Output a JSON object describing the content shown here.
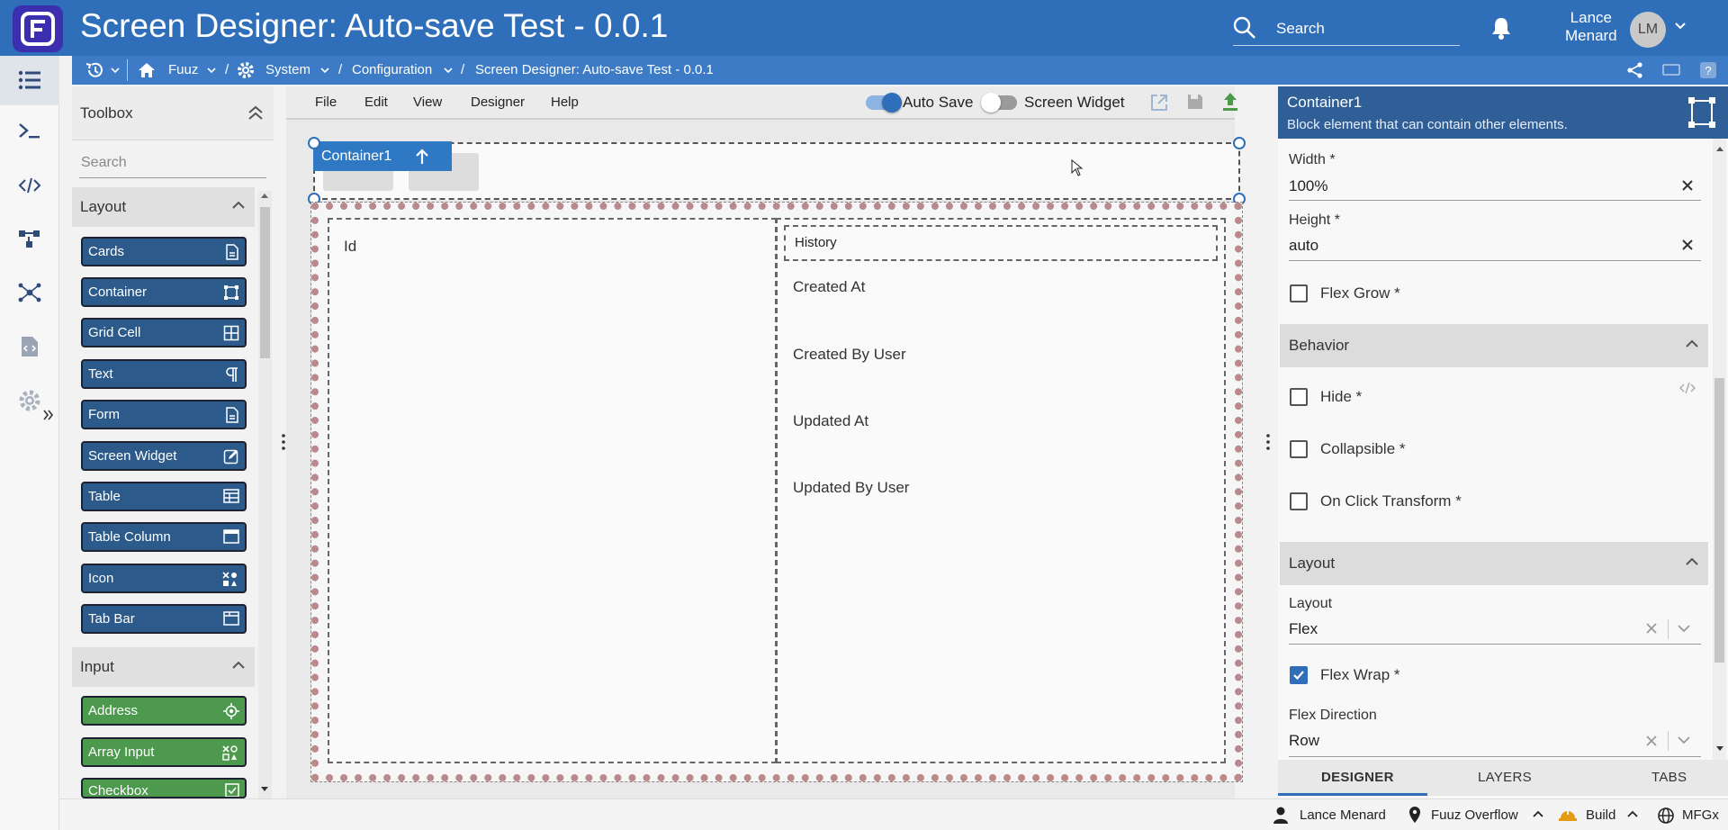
{
  "app": {
    "title": "Screen Designer: Auto-save Test - 0.0.1",
    "logo_letter": "F"
  },
  "header": {
    "search_label": "Search",
    "user_first": "Lance",
    "user_last": "Menard",
    "avatar_initials": "LM"
  },
  "breadcrumb": {
    "items": [
      "Fuuz",
      "System",
      "Configuration",
      "Screen Designer: Auto-save Test - 0.0.1"
    ]
  },
  "toolbox": {
    "title": "Toolbox",
    "search_placeholder": "Search",
    "layout_section": "Layout",
    "layout_items": [
      "Cards",
      "Container",
      "Grid Cell",
      "Text",
      "Form",
      "Screen Widget",
      "Table",
      "Table Column",
      "Icon",
      "Tab Bar"
    ],
    "input_section": "Input",
    "input_items": [
      "Address",
      "Array Input",
      "Checkbox"
    ]
  },
  "menubar": {
    "items": [
      "File",
      "Edit",
      "View",
      "Designer",
      "Help"
    ],
    "auto_save": "Auto Save",
    "screen_widget": "Screen Widget",
    "auto_save_on": true,
    "screen_widget_on": false
  },
  "canvas": {
    "selected_tag": "Container1",
    "left_field": "Id",
    "history_label": "History",
    "right_fields": [
      "Created At",
      "Created By User",
      "Updated At",
      "Updated By User"
    ]
  },
  "properties": {
    "title": "Container1",
    "description": "Block element that can contain other elements.",
    "width_label": "Width *",
    "width_value": "100%",
    "height_label": "Height *",
    "height_value": "auto",
    "flex_grow": "Flex Grow *",
    "behavior_section": "Behavior",
    "hide": "Hide *",
    "collapsible": "Collapsible *",
    "on_click_transform": "On Click Transform *",
    "layout_section": "Layout",
    "layout_label": "Layout",
    "layout_value": "Flex",
    "flex_wrap": "Flex Wrap *",
    "flex_wrap_checked": true,
    "flex_direction_label": "Flex Direction",
    "flex_direction_value": "Row"
  },
  "bottom_tabs": [
    "DESIGNER",
    "LAYERS",
    "TABS"
  ],
  "statusbar": {
    "user": "Lance Menard",
    "location": "Fuuz Overflow",
    "mode": "Build",
    "tenant": "MFGx"
  },
  "colors": {
    "header": "#2f6fba",
    "breadcrumb": "#3d7bc6",
    "layout_tool": "#2c5a8a",
    "input_tool": "#4d9a4f",
    "props_header": "#2f5f96"
  }
}
